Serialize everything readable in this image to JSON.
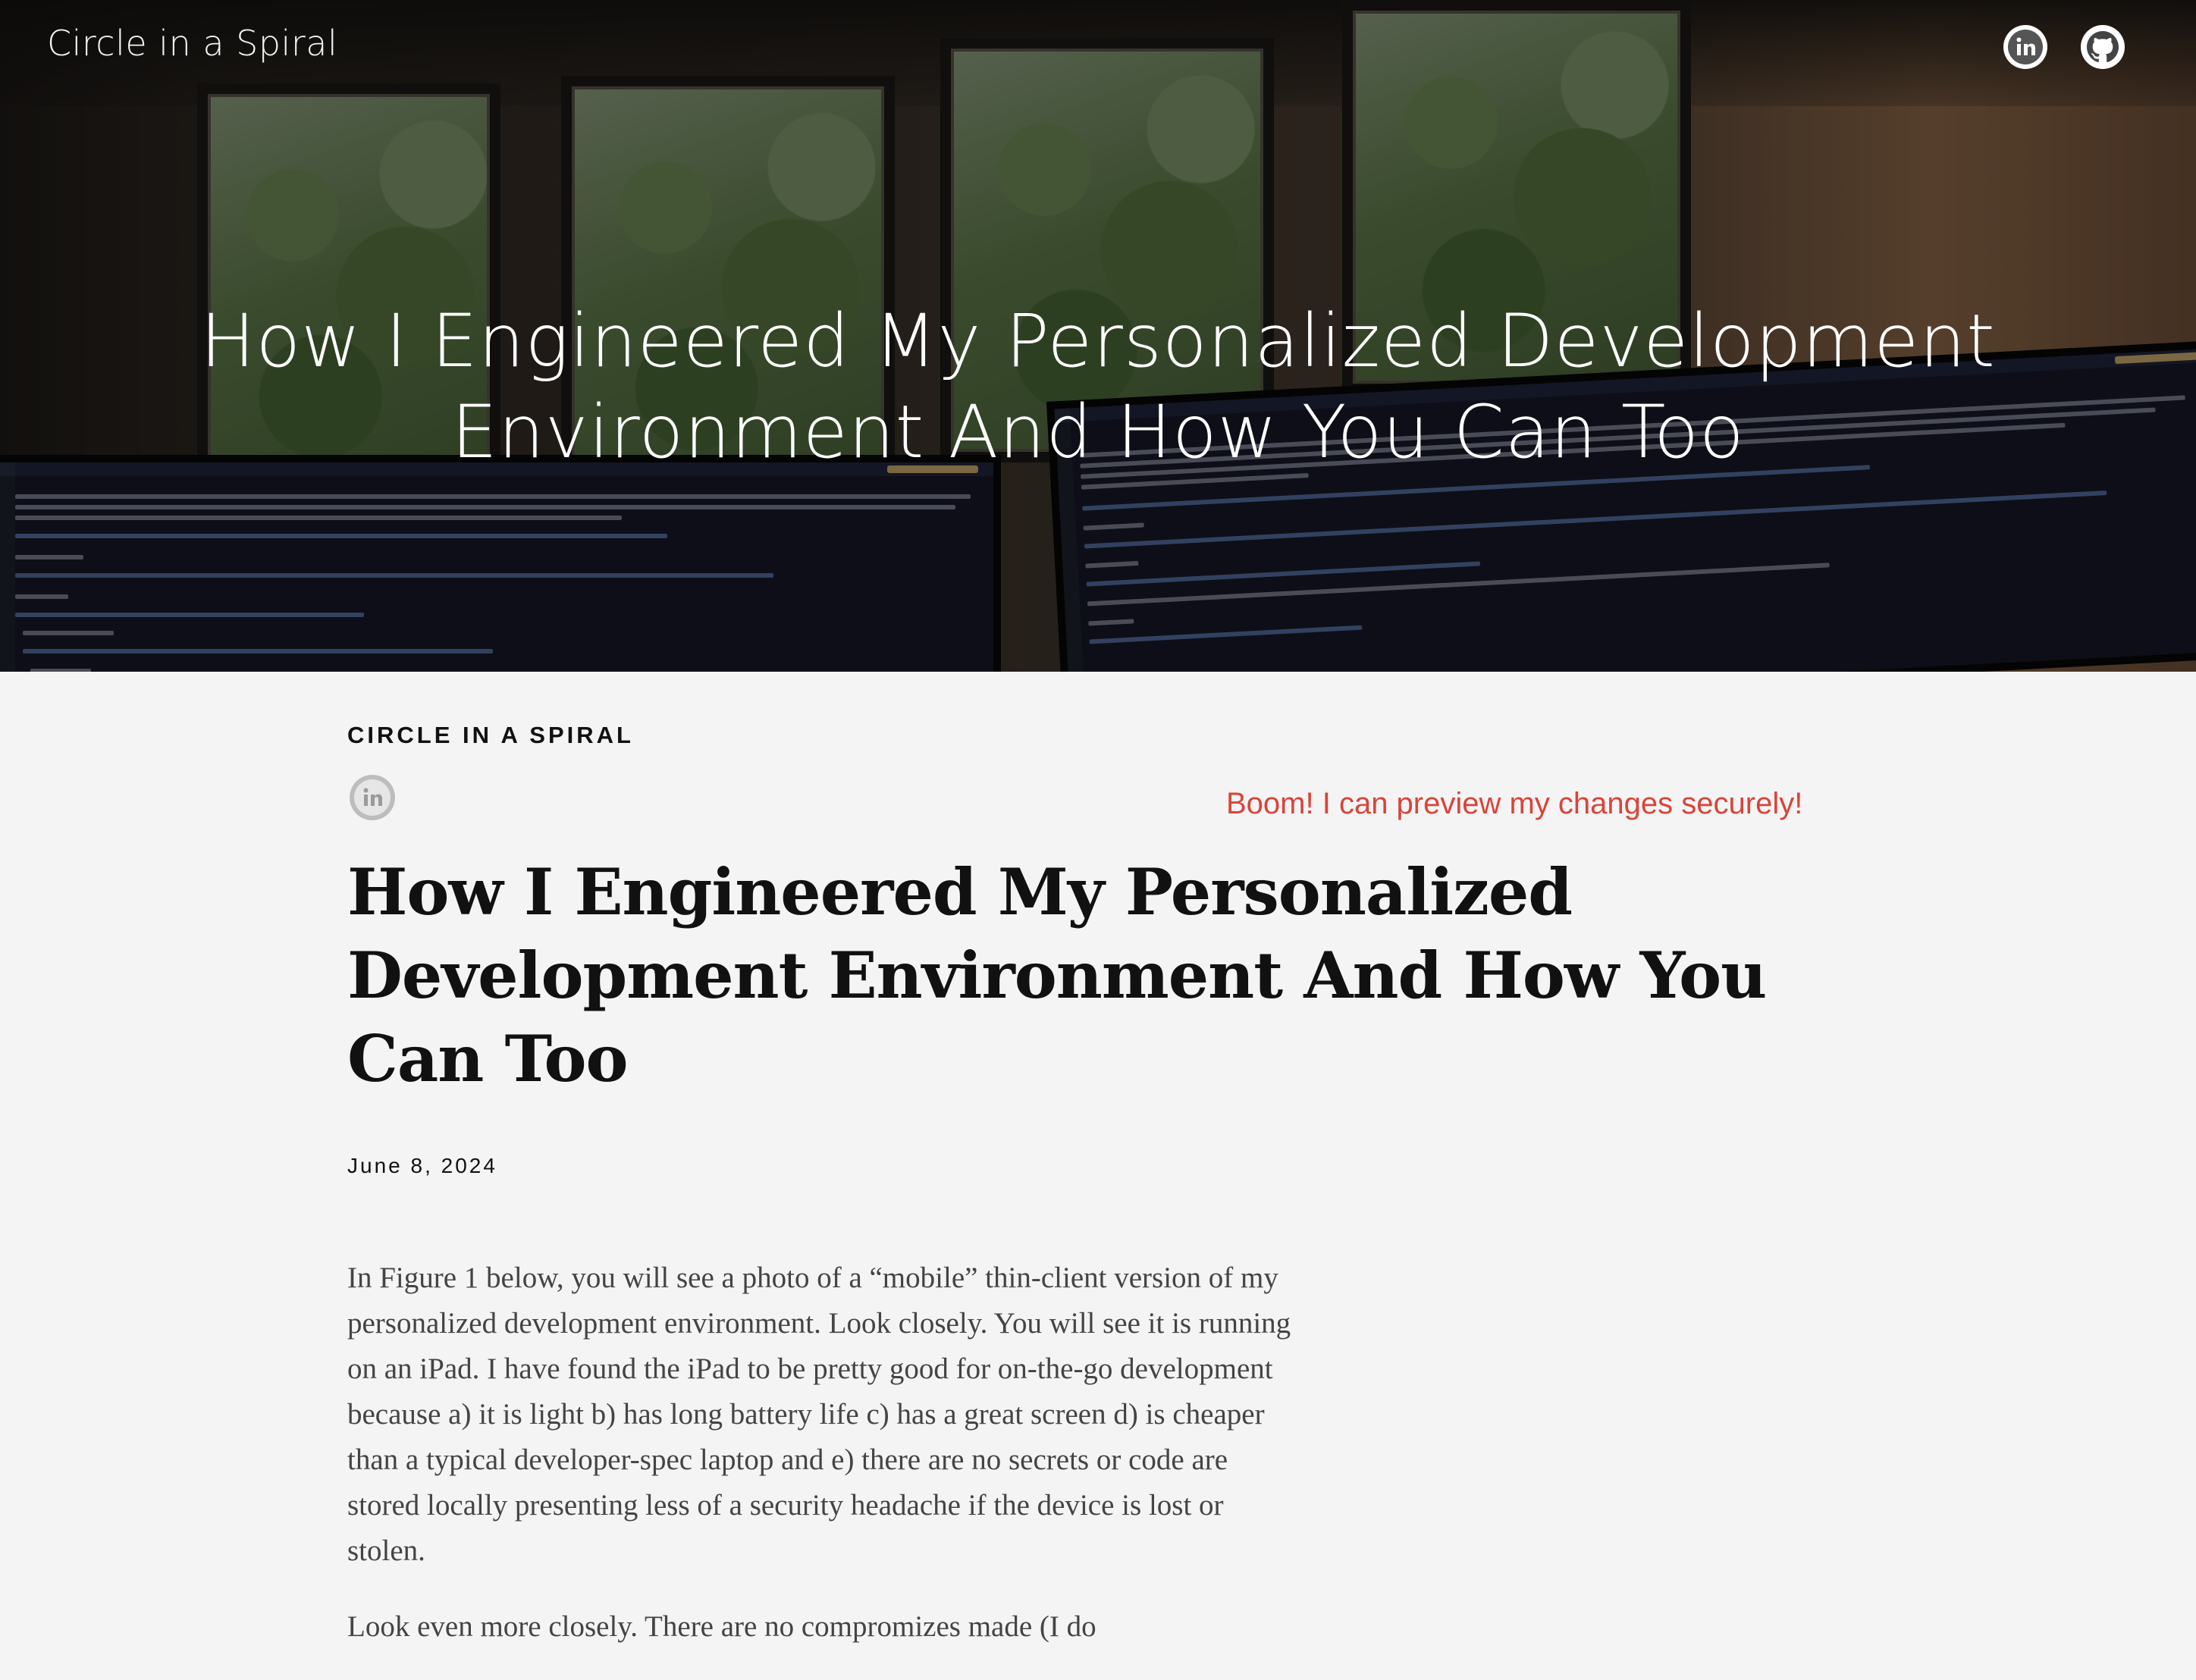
{
  "header": {
    "site_title": "Circle in a Spiral",
    "social_icons": [
      "linkedin-icon",
      "github-icon"
    ]
  },
  "hero": {
    "title": "How I Engineered My Personalized Development Environment And How You Can Too"
  },
  "article": {
    "site_label": "CIRCLE IN A SPIRAL",
    "note": "Boom! I can preview my changes securely!",
    "title": "How I Engineered My Personalized Development Environment And How You Can Too",
    "date": "June 8, 2024",
    "paragraphs": [
      "In Figure 1 below, you will see a photo of a “mobile” thin-client version of my personalized development environment. Look closely. You will see it is running on an iPad. I have found the iPad to be pretty good for on-the-go development because a) it is light b) has long battery life c) has a great screen d) is cheaper than a typical developer-spec laptop and e) there are no secrets or code are stored locally presenting less of a security headache if the device is lost or stolen.",
      "Look even more closely. There are no compromizes made (I do"
    ]
  },
  "colors": {
    "note": "#d9443a",
    "background": "#f4f4f4",
    "icon_gray": "#bdbdbd"
  }
}
